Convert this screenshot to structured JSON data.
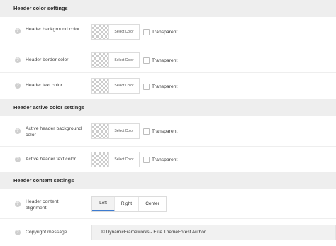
{
  "sections": [
    {
      "title": "Header color settings"
    },
    {
      "title": "Header active color settings"
    },
    {
      "title": "Header content settings"
    }
  ],
  "color_rows": [
    {
      "label": "Header background color",
      "picker_label": "Select Color",
      "checkbox_label": "Transparent"
    },
    {
      "label": "Header border color",
      "picker_label": "Select Color",
      "checkbox_label": "Transparent"
    },
    {
      "label": "Header text color",
      "picker_label": "Select Color",
      "checkbox_label": "Transparent"
    },
    {
      "label": "Active header background color",
      "picker_label": "Select Color",
      "checkbox_label": "Transparent"
    },
    {
      "label": "Active header text color",
      "picker_label": "Select Color",
      "checkbox_label": "Transparent"
    }
  ],
  "alignment": {
    "label": "Header content alignment",
    "options": [
      "Left",
      "Right",
      "Center"
    ],
    "selected": "Left"
  },
  "copyright": {
    "label": "Copyright message",
    "value": "© DynamicFrameworks - Elite ThemeForest Author."
  },
  "help_icon_glyph": "?",
  "colors": {
    "accent": "#3d7bd0",
    "section_bg": "#eeeeee"
  }
}
